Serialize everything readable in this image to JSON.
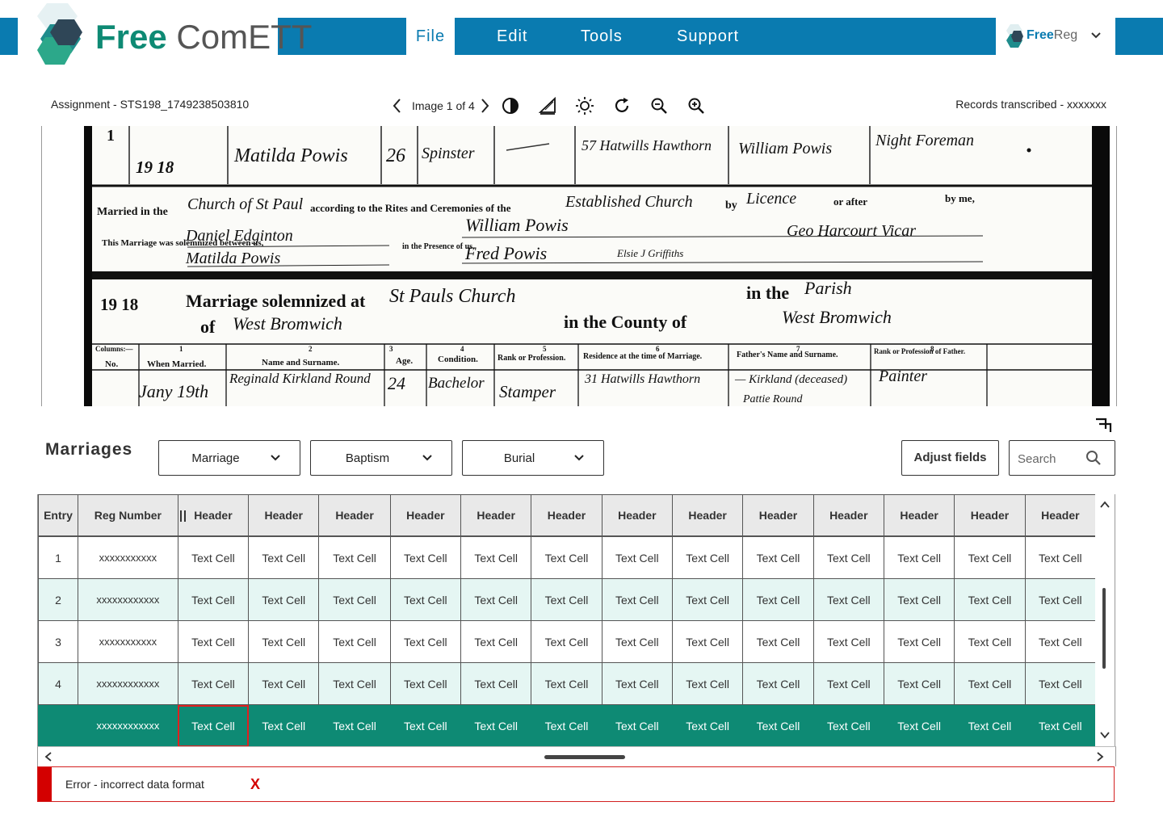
{
  "app": {
    "logo_free": "Free",
    "logo_comett": "ComETT",
    "menu": [
      {
        "label": "File",
        "active": true
      },
      {
        "label": "Edit",
        "active": false
      },
      {
        "label": "Tools",
        "active": false
      },
      {
        "label": "Support",
        "active": false
      }
    ],
    "freereg": {
      "bold": "Free",
      "regular": "Reg"
    },
    "colors": {
      "topbar": "#0a7bb0",
      "brand_green": "#0e8a74",
      "selected_row": "#0e8a74",
      "alt_row": "#e5f6f3",
      "error": "#d30000"
    }
  },
  "toolbar": {
    "assignment": "Assignment - STS198_1749238503810",
    "image_label": "Image 1 of 4",
    "records": "Records transcribed - xxxxxxx",
    "tools": [
      "contrast-icon",
      "levels-icon",
      "brightness-icon",
      "rotate-icon",
      "zoom-out-icon",
      "zoom-in-icon"
    ]
  },
  "document": {
    "row1": {
      "year": "19 18",
      "name": "Matilda Powis",
      "age": "26",
      "condition": "Spinster",
      "residence": "57 Hatwills Hawthorn",
      "father": "William Powis",
      "rank": "Night Foreman"
    },
    "married_line": {
      "prefix": "Married in the",
      "church": "Church of St Paul",
      "rites": "according to the Rites and Ceremonies of the",
      "est": "Established Church",
      "by": "by",
      "licence": "Licence",
      "after": "or after",
      "byme": "by me,"
    },
    "solemnized": {
      "label": "This Marriage was solemnized between us,",
      "p1": "Daniel Edginton",
      "p2": "Matilda Powis",
      "presence": "in the Presence of us,",
      "w1": "William Powis",
      "w2": "Fred Powis",
      "w3": "Elsie J Griffiths",
      "vicar": "Geo Harcourt Vicar"
    },
    "header2": {
      "year": "19 18",
      "title": "Marriage solemnized at",
      "church": "St Pauls Church",
      "inthe": "in the",
      "parish": "Parish",
      "of": "of",
      "place": "West Bromwich",
      "county": "in the County of",
      "county_name": "West Bromwich"
    },
    "columns": [
      "No.",
      "When Married.",
      "Name and Surname.",
      "Age.",
      "Condition.",
      "Rank or Profession.",
      "Residence at the time of Marriage.",
      "Father's Name and Surname.",
      "Rank or Profession of Father."
    ],
    "column_numbers": [
      "Columns:—",
      "1",
      "2",
      "3",
      "4",
      "5",
      "6",
      "7",
      "8"
    ],
    "row2": {
      "date": "Jany 19th",
      "name": "Reginald Kirkland Round",
      "age": "24",
      "condition": "Bachelor",
      "rank": "Stamper",
      "residence": "31 Hatwills Hawthorn",
      "father": "— Kirkland (deceased)",
      "father2": "Pattie Round",
      "father_rank": "Painter"
    },
    "entry_num": "1"
  },
  "controls": {
    "section_title": "Marriages",
    "dropdowns": [
      "Marriage",
      "Baptism",
      "Burial"
    ],
    "adjust_fields": "Adjust fields",
    "search_placeholder": "Search"
  },
  "table": {
    "headers": [
      "Entry",
      "Reg Number",
      "Header",
      "Header",
      "Header",
      "Header",
      "Header",
      "Header",
      "Header",
      "Header",
      "Header",
      "Header",
      "Header",
      "Header",
      "Header"
    ],
    "rows": [
      [
        "1",
        "xxxxxxxxxxx",
        "Text Cell",
        "Text Cell",
        "Text Cell",
        "Text Cell",
        "Text Cell",
        "Text Cell",
        "Text Cell",
        "Text Cell",
        "Text Cell",
        "Text Cell",
        "Text Cell",
        "Text Cell",
        "Text Cell"
      ],
      [
        "2",
        "xxxxxxxxxxxx",
        "Text Cell",
        "Text Cell",
        "Text Cell",
        "Text Cell",
        "Text Cell",
        "Text Cell",
        "Text Cell",
        "Text Cell",
        "Text Cell",
        "Text Cell",
        "Text Cell",
        "Text Cell",
        "Text Cell"
      ],
      [
        "3",
        "xxxxxxxxxxx",
        "Text Cell",
        "Text Cell",
        "Text Cell",
        "Text Cell",
        "Text Cell",
        "Text Cell",
        "Text Cell",
        "Text Cell",
        "Text Cell",
        "Text Cell",
        "Text Cell",
        "Text Cell",
        "Text Cell"
      ],
      [
        "4",
        "xxxxxxxxxxxx",
        "Text Cell",
        "Text Cell",
        "Text Cell",
        "Text Cell",
        "Text Cell",
        "Text Cell",
        "Text Cell",
        "Text Cell",
        "Text Cell",
        "Text Cell",
        "Text Cell",
        "Text Cell",
        "Text Cell"
      ],
      [
        "",
        "xxxxxxxxxxxx",
        "Text Cell",
        "Text Cell",
        "Text Cell",
        "Text Cell",
        "Text Cell",
        "Text Cell",
        "Text Cell",
        "Text Cell",
        "Text Cell",
        "Text Cell",
        "Text Cell",
        "Text Cell",
        "Text Cell"
      ]
    ],
    "selected_row": 4,
    "focused_cell": 2
  },
  "error": {
    "message": "Error - incorrect data format",
    "close": "X"
  }
}
